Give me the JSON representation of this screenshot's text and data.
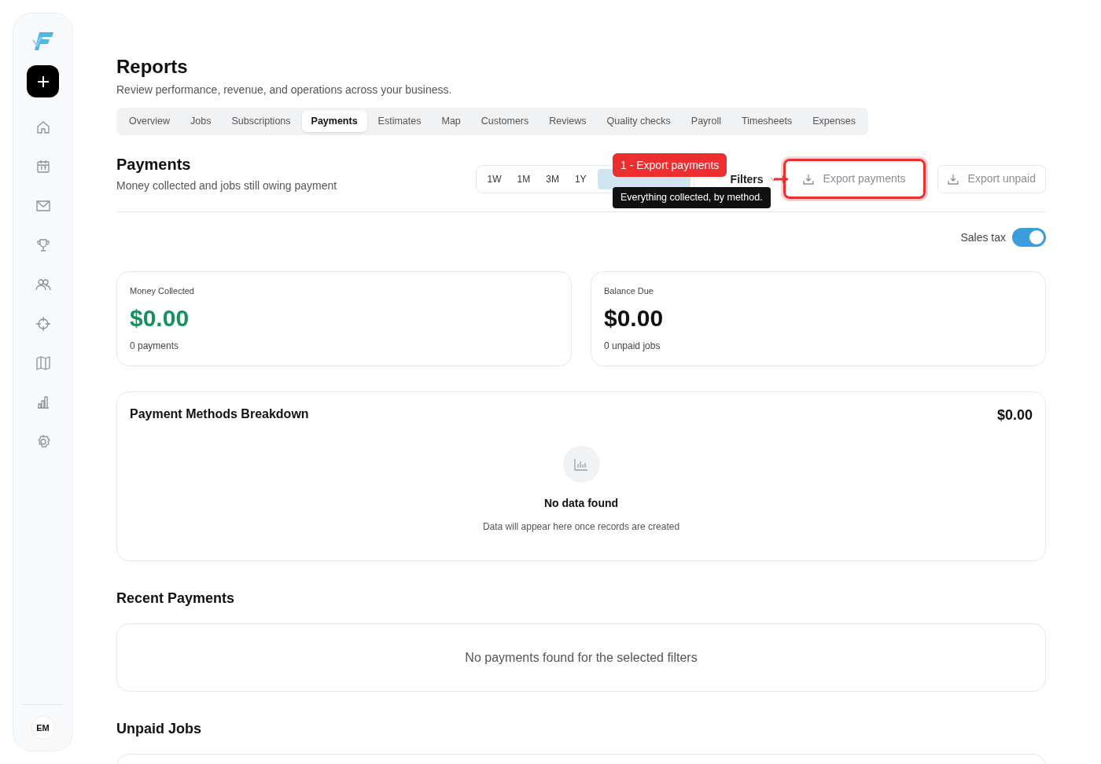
{
  "sidebar": {
    "avatar": "EM"
  },
  "page": {
    "title": "Reports",
    "subtitle": "Review performance, revenue, and operations across your business."
  },
  "tabs": [
    {
      "label": "Overview",
      "selected": false
    },
    {
      "label": "Jobs",
      "selected": false
    },
    {
      "label": "Subscriptions",
      "selected": false
    },
    {
      "label": "Payments",
      "selected": true
    },
    {
      "label": "Estimates",
      "selected": false
    },
    {
      "label": "Map",
      "selected": false
    },
    {
      "label": "Customers",
      "selected": false
    },
    {
      "label": "Reviews",
      "selected": false
    },
    {
      "label": "Quality checks",
      "selected": false
    },
    {
      "label": "Payroll",
      "selected": false
    },
    {
      "label": "Timesheets",
      "selected": false
    },
    {
      "label": "Expenses",
      "selected": false
    }
  ],
  "section": {
    "title": "Payments",
    "subtitle": "Money collected and jobs still owing payment"
  },
  "ranges": [
    {
      "label": "1W"
    },
    {
      "label": "1M"
    },
    {
      "label": "3M"
    },
    {
      "label": "1Y"
    }
  ],
  "filters": {
    "label": "Filters"
  },
  "annotation": {
    "badge": "1 - Export payments",
    "tooltip": "Everything collected, by method."
  },
  "export_buttons": [
    {
      "label": "Export payments",
      "highlighted": true
    },
    {
      "label": "Export unpaid",
      "highlighted": false
    }
  ],
  "sales_tax": {
    "label": "Sales tax",
    "on": true
  },
  "cards": [
    {
      "label": "Money Collected",
      "amount": "$0.00",
      "note": "0 payments",
      "color": "#15935f"
    },
    {
      "label": "Balance Due",
      "amount": "$0.00",
      "note": "0 unpaid jobs",
      "color": "#111111"
    }
  ],
  "breakdown": {
    "title": "Payment Methods Breakdown",
    "total": "$0.00",
    "empty_title": "No data found",
    "empty_text": "Data will appear here once records are created"
  },
  "recent_payments": {
    "title": "Recent Payments",
    "empty_text": "No payments found for the selected filters"
  },
  "unpaid_jobs": {
    "title": "Unpaid Jobs"
  }
}
